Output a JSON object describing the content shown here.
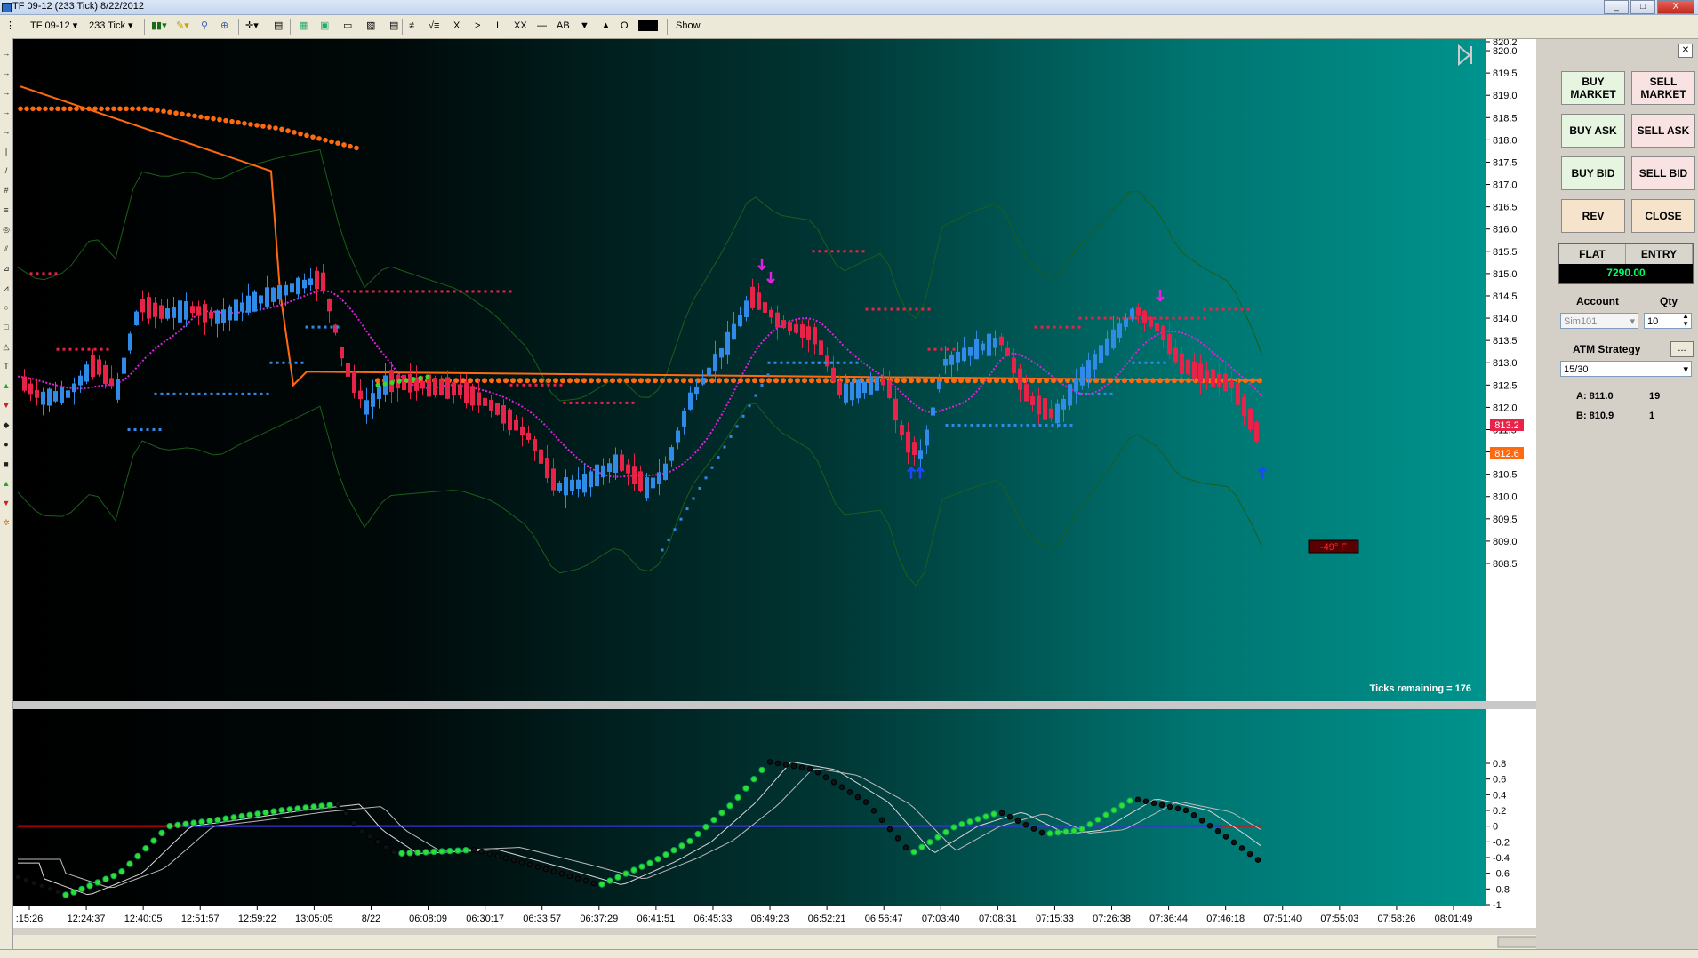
{
  "window": {
    "title": "TF 09-12 (233 Tick)  8/22/2012",
    "btn_min": "_",
    "btn_max": "□",
    "btn_close": "X"
  },
  "toolbar": {
    "instrument": "TF 09-12",
    "interval": "233 Tick",
    "show_label": "Show",
    "draw_tools": [
      "≠",
      "√≡",
      "X",
      ">",
      "I",
      "XX",
      "—",
      "AB",
      "▼",
      "▲",
      "O"
    ]
  },
  "chart": {
    "price_ticks": [
      "820.2",
      "820.0",
      "819.5",
      "819.0",
      "818.5",
      "818.0",
      "817.5",
      "817.0",
      "816.5",
      "816.0",
      "815.5",
      "815.0",
      "814.5",
      "814.0",
      "813.5",
      "813.0",
      "812.5",
      "812.0",
      "811.5",
      "811.0",
      "810.5",
      "810.0",
      "809.5",
      "809.0",
      "808.5"
    ],
    "price_badge_red": "813.2",
    "price_badge_orange": "812.6",
    "ticks_remaining": "Ticks remaining = 176",
    "angle_label": "-49°  F",
    "osc_ticks": [
      "0.8",
      "0.6",
      "0.4",
      "0.2",
      "0",
      "-0.2",
      "-0.4",
      "-0.6",
      "-0.8",
      "-1"
    ],
    "time_ticks": [
      ":15:26",
      "12:24:37",
      "12:40:05",
      "12:51:57",
      "12:59:22",
      "13:05:05",
      "8/22",
      "06:08:09",
      "06:30:17",
      "06:33:57",
      "06:37:29",
      "06:41:51",
      "06:45:33",
      "06:49:23",
      "06:52:21",
      "06:56:47",
      "07:03:40",
      "07:08:31",
      "07:15:33",
      "07:26:38",
      "07:36:44",
      "07:46:18",
      "07:51:40",
      "07:55:03",
      "07:58:26",
      "08:01:49"
    ],
    "colors": {
      "up": "#2f8ae8",
      "down": "#e8234a",
      "orange": "#ff6a10",
      "magenta": "#e020e0",
      "green_dots": "#33dd33",
      "bg_left": "#000000",
      "bg_right": "#009690"
    }
  },
  "panel": {
    "buy_market": "BUY MARKET",
    "sell_market": "SELL MARKET",
    "buy_ask": "BUY ASK",
    "sell_ask": "SELL ASK",
    "buy_bid": "BUY BID",
    "sell_bid": "SELL BID",
    "rev": "REV",
    "close": "CLOSE",
    "flat": "FLAT",
    "entry": "ENTRY",
    "pnl": "7290.00",
    "account_label": "Account",
    "qty_label": "Qty",
    "account_value": "Sim101",
    "qty_value": "10",
    "atm_label": "ATM Strategy",
    "atm_btn": "...",
    "atm_value": "15/30",
    "ask_label": "A: 811.0",
    "ask_size": "19",
    "bid_label": "B: 810.9",
    "bid_size": "1"
  }
}
